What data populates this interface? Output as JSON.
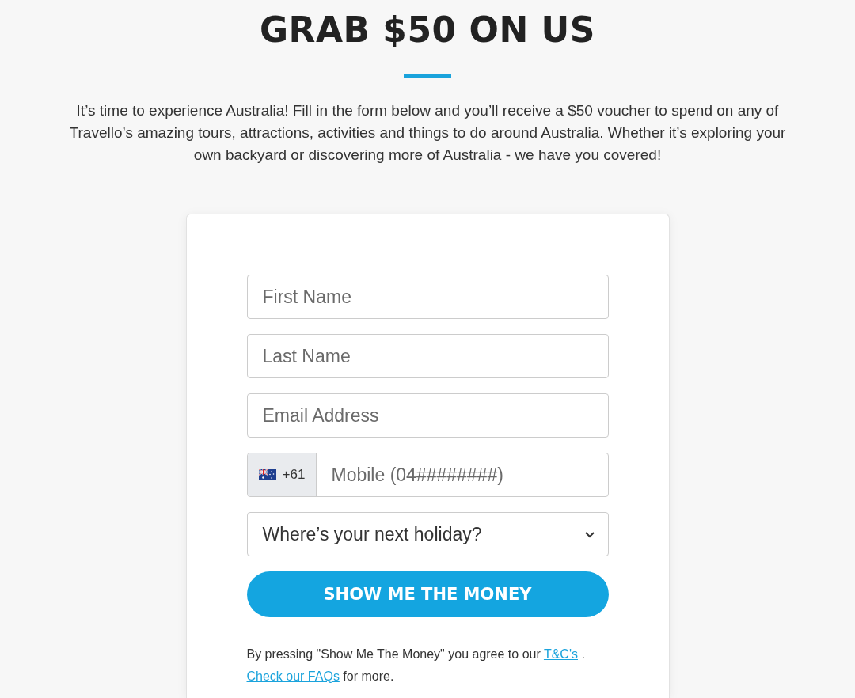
{
  "heading": "GRAB $50 ON US",
  "intro": "It’s time to experience Australia! Fill in the form below and you’ll receive a $50 voucher to spend on any of Travello’s amazing tours, attractions, activities and things to do around Australia. Whether it’s exploring your own backyard or discovering more of Australia - we have you covered!",
  "form": {
    "fields": [
      {
        "kind": "text",
        "placeholder": "First Name"
      },
      {
        "kind": "text",
        "placeholder": "Last Name"
      },
      {
        "kind": "text",
        "placeholder": "Email Address"
      },
      {
        "kind": "phone",
        "prefix": "+61",
        "placeholder": "Mobile (04########)"
      },
      {
        "kind": "select",
        "value": "Where’s your next holiday?"
      }
    ],
    "submit": "SHOW ME THE MONEY",
    "disclaimer": {
      "text": "By pressing \"Show Me The Money\" you agree to our",
      "links": [
        {
          "label": "T&C's"
        },
        {
          "label": "Check our FAQs"
        }
      ],
      "separator": ".",
      "tail": "for more."
    }
  }
}
